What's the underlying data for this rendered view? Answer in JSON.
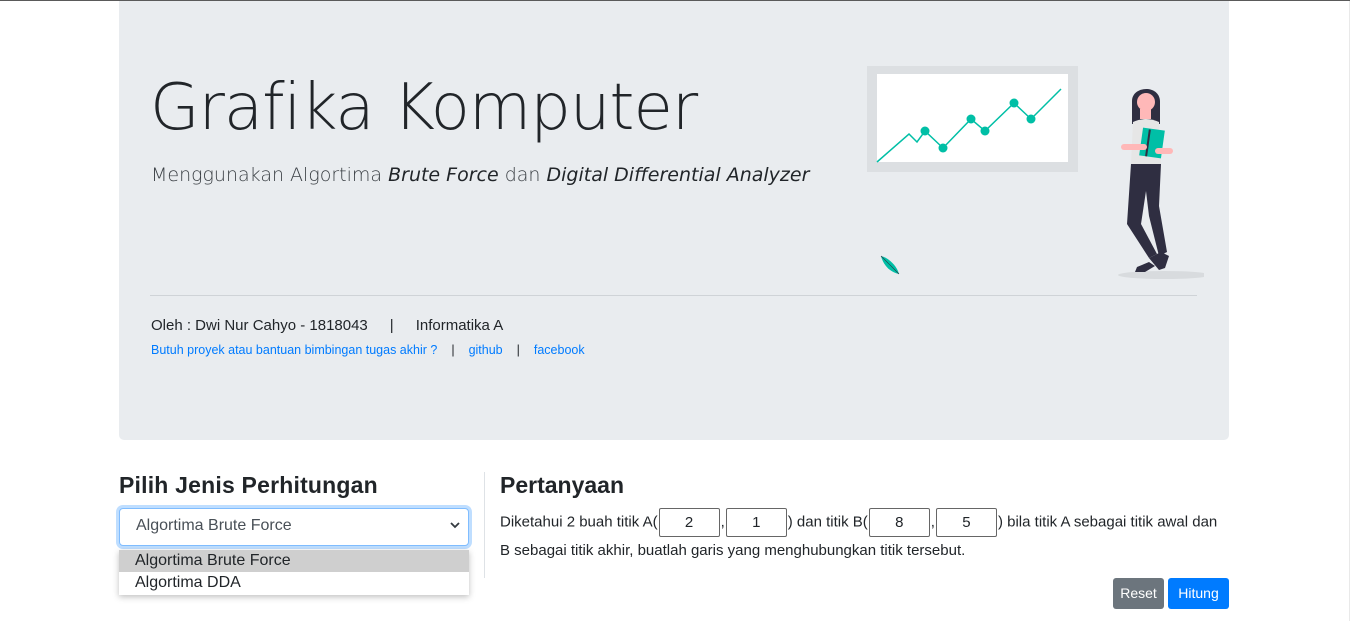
{
  "header": {
    "title": "Grafika Komputer",
    "lead_prefix": "Menggunakan Algortima ",
    "lead_em1": "Brute Force",
    "lead_mid": " dan ",
    "lead_em2": "Digital Differential Analyzer",
    "author": "Oleh : Dwi Nur Cahyo - 1818043",
    "author_sep": "|",
    "class_name": "Informatika A",
    "link_help": "Butuh proyek atau bantuan bimbingan tugas akhir ?",
    "link_sep": "|",
    "link_github": "github",
    "link_facebook": "facebook"
  },
  "calc_type": {
    "heading": "Pilih Jenis Perhitungan",
    "selected": "Algortima Brute Force",
    "options": [
      "Algortima Brute Force",
      "Algortima DDA"
    ]
  },
  "question": {
    "heading": "Pertanyaan",
    "text_1": "Diketahui 2 buah titik A(",
    "comma": ",",
    "text_2": ") dan titik B(",
    "text_3": ") bila titik A sebagai titik awal dan B sebagai titik akhir, buatlah garis yang menghubungkan titik tersebut.",
    "ax": "2",
    "ay": "1",
    "bx": "8",
    "by": "5"
  },
  "buttons": {
    "reset": "Reset",
    "hitung": "Hitung"
  },
  "colors": {
    "accent": "#007bff",
    "teal": "#00bfa6",
    "jumbotron_bg": "#e9ecef"
  }
}
